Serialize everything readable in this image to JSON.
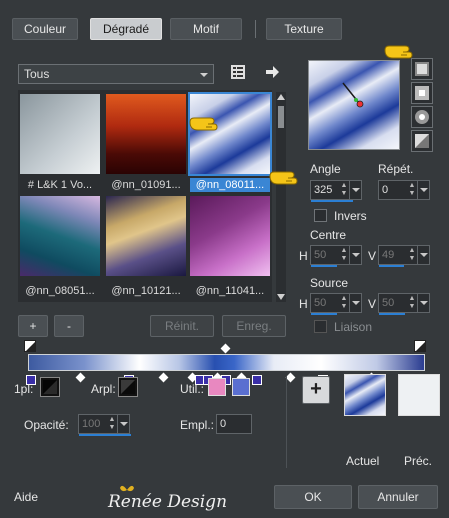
{
  "tabs": {
    "couleur": "Couleur",
    "degrade": "Dégradé",
    "motif": "Motif",
    "texture": "Texture"
  },
  "category": {
    "selected": "Tous"
  },
  "thumbnails": [
    {
      "label": "# L&K 1 Vo..."
    },
    {
      "label": "@nn_01091..."
    },
    {
      "label": "@nn_08011..."
    },
    {
      "label": "@nn_08051..."
    },
    {
      "label": "@nn_10121..."
    },
    {
      "label": "@nn_11041..."
    }
  ],
  "angle": {
    "label": "Angle",
    "value": "325"
  },
  "repeat": {
    "label": "Répét.",
    "value": "0"
  },
  "invert": {
    "label": "Invers"
  },
  "center": {
    "label": "Centre",
    "h_label": "H",
    "h_value": "50",
    "v_label": "V",
    "v_value": "49"
  },
  "source": {
    "label": "Source",
    "h_label": "H",
    "h_value": "50",
    "v_label": "V",
    "v_value": "50"
  },
  "link": {
    "label": "Liaison"
  },
  "editor": {
    "add": "+",
    "remove": "-",
    "reset": "Réinit.",
    "save": "Enreg."
  },
  "stops": {
    "first_plane": "1pl:",
    "back_plane": "Arpl:",
    "use_label": "Util.:",
    "opacity_label": "Opacité:",
    "opacity_value": "100",
    "position_label": "Empl.:",
    "position_value": "0"
  },
  "preview": {
    "add": "+",
    "current": "Actuel",
    "previous": "Préc."
  },
  "footer": {
    "help": "Aide",
    "ok": "OK",
    "cancel": "Annuler",
    "watermark": "Renée Design"
  },
  "colors": {
    "accent": "#2b7fd4",
    "swatch_pink": "#e888c0",
    "swatch_blue": "#5a6fd0"
  }
}
